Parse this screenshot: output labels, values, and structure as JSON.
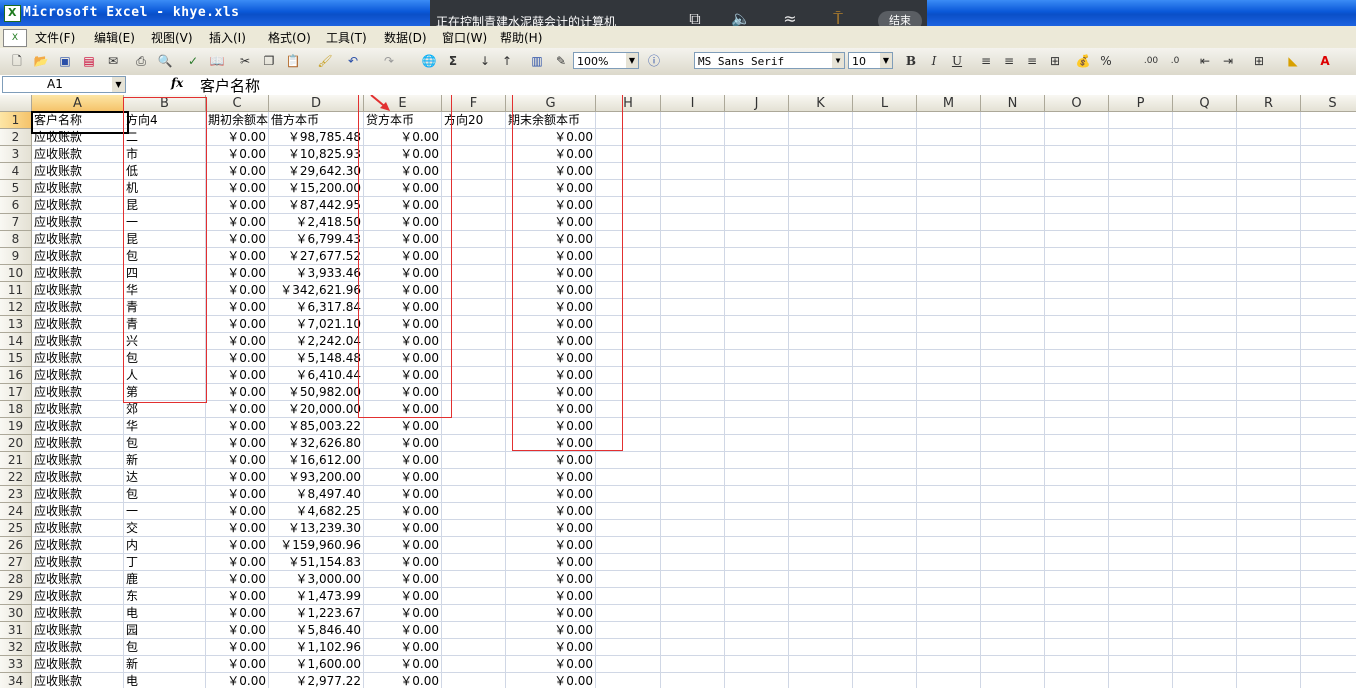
{
  "window": {
    "title": "Microsoft Excel - khye.xls"
  },
  "remote": {
    "message": "正在控制青建水泥薛会计的计算机",
    "end_label": "结束"
  },
  "menu": [
    "文件(F)",
    "编辑(E)",
    "视图(V)",
    "插入(I)",
    "格式(O)",
    "工具(T)",
    "数据(D)",
    "窗口(W)",
    "帮助(H)"
  ],
  "toolbar": {
    "zoom": "100%",
    "font": "MS Sans Serif",
    "font_size": "10",
    "sigma": "Σ",
    "percent": "%"
  },
  "formula_bar": {
    "name_box": "A1",
    "fx": "fx",
    "value": "客户名称"
  },
  "sheet": {
    "columns": [
      "A",
      "B",
      "C",
      "D",
      "E",
      "F",
      "G",
      "H",
      "I",
      "J",
      "K",
      "L",
      "M",
      "N",
      "O",
      "P",
      "Q",
      "R",
      "S"
    ],
    "headers": [
      "客户名称",
      "方向4",
      "期初余额本",
      "借方本币",
      "贷方本币",
      "方向20",
      "期末余额本币"
    ],
    "rows": [
      [
        "应收账款",
        "二",
        "￥0.00",
        "￥98,785.48",
        "￥0.00",
        "",
        "￥0.00"
      ],
      [
        "应收账款",
        "市",
        "￥0.00",
        "￥10,825.93",
        "￥0.00",
        "",
        "￥0.00"
      ],
      [
        "应收账款",
        "低",
        "￥0.00",
        "￥29,642.30",
        "￥0.00",
        "",
        "￥0.00"
      ],
      [
        "应收账款",
        "机",
        "￥0.00",
        "￥15,200.00",
        "￥0.00",
        "",
        "￥0.00"
      ],
      [
        "应收账款",
        "昆",
        "￥0.00",
        "￥87,442.95",
        "￥0.00",
        "",
        "￥0.00"
      ],
      [
        "应收账款",
        "一",
        "￥0.00",
        "￥2,418.50",
        "￥0.00",
        "",
        "￥0.00"
      ],
      [
        "应收账款",
        "昆",
        "￥0.00",
        "￥6,799.43",
        "￥0.00",
        "",
        "￥0.00"
      ],
      [
        "应收账款",
        "包",
        "￥0.00",
        "￥27,677.52",
        "￥0.00",
        "",
        "￥0.00"
      ],
      [
        "应收账款",
        "四",
        "￥0.00",
        "￥3,933.46",
        "￥0.00",
        "",
        "￥0.00"
      ],
      [
        "应收账款",
        "华",
        "￥0.00",
        "￥342,621.96",
        "￥0.00",
        "",
        "￥0.00"
      ],
      [
        "应收账款",
        "青",
        "￥0.00",
        "￥6,317.84",
        "￥0.00",
        "",
        "￥0.00"
      ],
      [
        "应收账款",
        "青",
        "￥0.00",
        "￥7,021.10",
        "￥0.00",
        "",
        "￥0.00"
      ],
      [
        "应收账款",
        "兴",
        "￥0.00",
        "￥2,242.04",
        "￥0.00",
        "",
        "￥0.00"
      ],
      [
        "应收账款",
        "包",
        "￥0.00",
        "￥5,148.48",
        "￥0.00",
        "",
        "￥0.00"
      ],
      [
        "应收账款",
        "人",
        "￥0.00",
        "￥6,410.44",
        "￥0.00",
        "",
        "￥0.00"
      ],
      [
        "应收账款",
        "第",
        "￥0.00",
        "￥50,982.00",
        "￥0.00",
        "",
        "￥0.00"
      ],
      [
        "应收账款",
        "郊",
        "￥0.00",
        "￥20,000.00",
        "￥0.00",
        "",
        "￥0.00"
      ],
      [
        "应收账款",
        "华",
        "￥0.00",
        "￥85,003.22",
        "￥0.00",
        "",
        "￥0.00"
      ],
      [
        "应收账款",
        "包",
        "￥0.00",
        "￥32,626.80",
        "￥0.00",
        "",
        "￥0.00"
      ],
      [
        "应收账款",
        "新",
        "￥0.00",
        "￥16,612.00",
        "￥0.00",
        "",
        "￥0.00"
      ],
      [
        "应收账款",
        "达",
        "￥0.00",
        "￥93,200.00",
        "￥0.00",
        "",
        "￥0.00"
      ],
      [
        "应收账款",
        "包",
        "￥0.00",
        "￥8,497.40",
        "￥0.00",
        "",
        "￥0.00"
      ],
      [
        "应收账款",
        "一",
        "￥0.00",
        "￥4,682.25",
        "￥0.00",
        "",
        "￥0.00"
      ],
      [
        "应收账款",
        "交",
        "￥0.00",
        "￥13,239.30",
        "￥0.00",
        "",
        "￥0.00"
      ],
      [
        "应收账款",
        "内",
        "￥0.00",
        "￥159,960.96",
        "￥0.00",
        "",
        "￥0.00"
      ],
      [
        "应收账款",
        "丁",
        "￥0.00",
        "￥51,154.83",
        "￥0.00",
        "",
        "￥0.00"
      ],
      [
        "应收账款",
        "鹿",
        "￥0.00",
        "￥3,000.00",
        "￥0.00",
        "",
        "￥0.00"
      ],
      [
        "应收账款",
        "东",
        "￥0.00",
        "￥1,473.99",
        "￥0.00",
        "",
        "￥0.00"
      ],
      [
        "应收账款",
        "电",
        "￥0.00",
        "￥1,223.67",
        "￥0.00",
        "",
        "￥0.00"
      ],
      [
        "应收账款",
        "园",
        "￥0.00",
        "￥5,846.40",
        "￥0.00",
        "",
        "￥0.00"
      ],
      [
        "应收账款",
        "包",
        "￥0.00",
        "￥1,102.96",
        "￥0.00",
        "",
        "￥0.00"
      ],
      [
        "应收账款",
        "新",
        "￥0.00",
        "￥1,600.00",
        "￥0.00",
        "",
        "￥0.00"
      ],
      [
        "应收账款",
        "电",
        "￥0.00",
        "￥2,977.22",
        "￥0.00",
        "",
        "￥0.00"
      ]
    ]
  },
  "colors": {
    "title_bar": "#0a58d8",
    "annotation": "#e23030",
    "grid_line": "#d0d7e5"
  }
}
